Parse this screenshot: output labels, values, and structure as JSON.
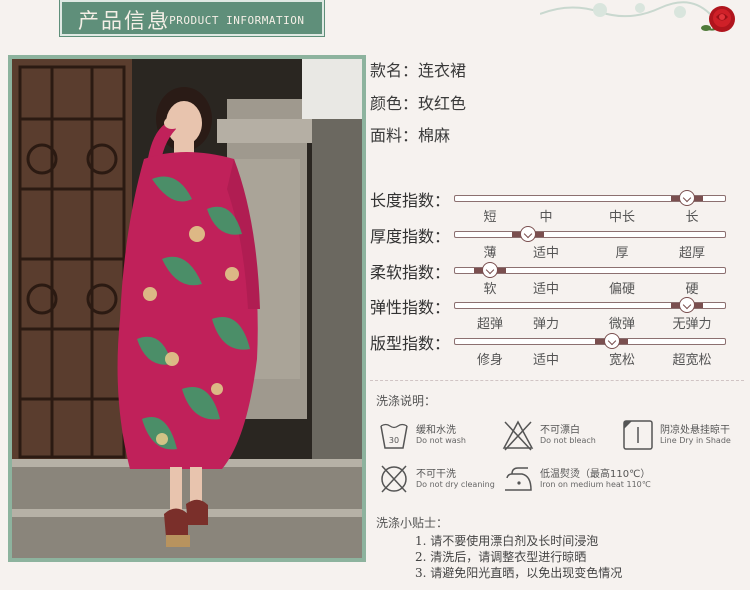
{
  "header": {
    "title": "产品信息",
    "subtitle": "/PRODUCT INFORMATION"
  },
  "info": [
    {
      "label": "款名：",
      "value": "连衣裙"
    },
    {
      "label": "颜色：",
      "value": "玫红色"
    },
    {
      "label": "面料：",
      "value": "棉麻"
    }
  ],
  "scales": [
    {
      "label": "长度指数：",
      "ticks": [
        "短",
        "中",
        "中长",
        "长"
      ],
      "level": 0.86
    },
    {
      "label": "厚度指数：",
      "ticks": [
        "薄",
        "适中",
        "厚",
        "超厚"
      ],
      "level": 0.27
    },
    {
      "label": "柔软指数：",
      "ticks": [
        "软",
        "适中",
        "偏硬",
        "硬"
      ],
      "level": 0.13
    },
    {
      "label": "弹性指数：",
      "ticks": [
        "超弹",
        "弹力",
        "微弹",
        "无弹力"
      ],
      "level": 0.86
    },
    {
      "label": "版型指数：",
      "ticks": [
        "修身",
        "适中",
        "宽松",
        "超宽松"
      ],
      "level": 0.58
    }
  ],
  "care": {
    "title": "洗涤说明：",
    "items": [
      {
        "icon": "hand-wash-icon",
        "cn": "缓和水洗",
        "en": "Do not wash"
      },
      {
        "icon": "no-bleach-icon",
        "cn": "不可漂白",
        "en": "Do not bleach"
      },
      {
        "icon": "line-dry-shade-icon",
        "cn": "阴凉处悬挂晾干",
        "en": "Line Dry in Shade"
      },
      {
        "icon": "no-dry-clean-icon",
        "cn": "不可干洗",
        "en": "Do not dry cleaning"
      },
      {
        "icon": "iron-low-heat-icon",
        "cn": "低温熨烫（最高110℃）",
        "en": "Iron on medium heat 110℃"
      }
    ]
  },
  "tips": {
    "title": "洗涤小贴士：",
    "items": [
      "1. 请不要使用漂白剂及长时间浸泡",
      "2. 清洗后，请调整衣型进行晾晒",
      "3. 请避免阳光直晒，以免出现变色情况"
    ]
  },
  "colors": {
    "header_band": "#5f8f7a",
    "dress": "#c0215a",
    "track_fill": "#7a4f4f"
  }
}
